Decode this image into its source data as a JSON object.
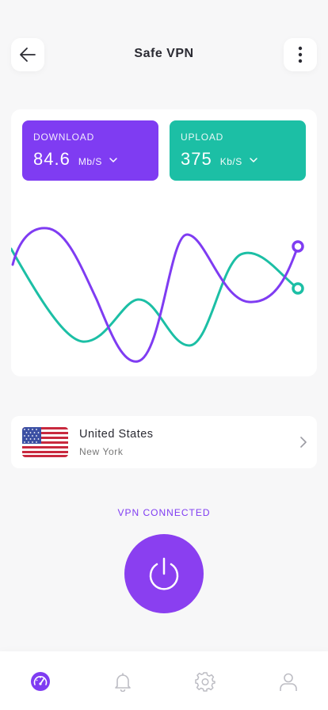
{
  "header": {
    "title": "Safe VPN",
    "back_icon": "arrow-left-icon",
    "more_icon": "more-vertical-icon"
  },
  "stats": {
    "download": {
      "label": "DOWNLOAD",
      "value": "84.6",
      "unit": "Mb/S"
    },
    "upload": {
      "label": "UPLOAD",
      "value": "375",
      "unit": "Kb/S"
    }
  },
  "location": {
    "country": "United States",
    "city": "New York",
    "flag_icon": "us-flag-icon"
  },
  "connection": {
    "status": "VPN CONNECTED"
  },
  "tabs": [
    {
      "icon": "speedometer-icon",
      "active": true
    },
    {
      "icon": "bell-icon",
      "active": false
    },
    {
      "icon": "gear-icon",
      "active": false
    },
    {
      "icon": "user-icon",
      "active": false
    }
  ],
  "colors": {
    "accent_purple": "#7f3cf2",
    "accent_teal": "#1cbfa5",
    "background": "#f7f7f8",
    "inactive_icon": "#bdbdc4"
  }
}
